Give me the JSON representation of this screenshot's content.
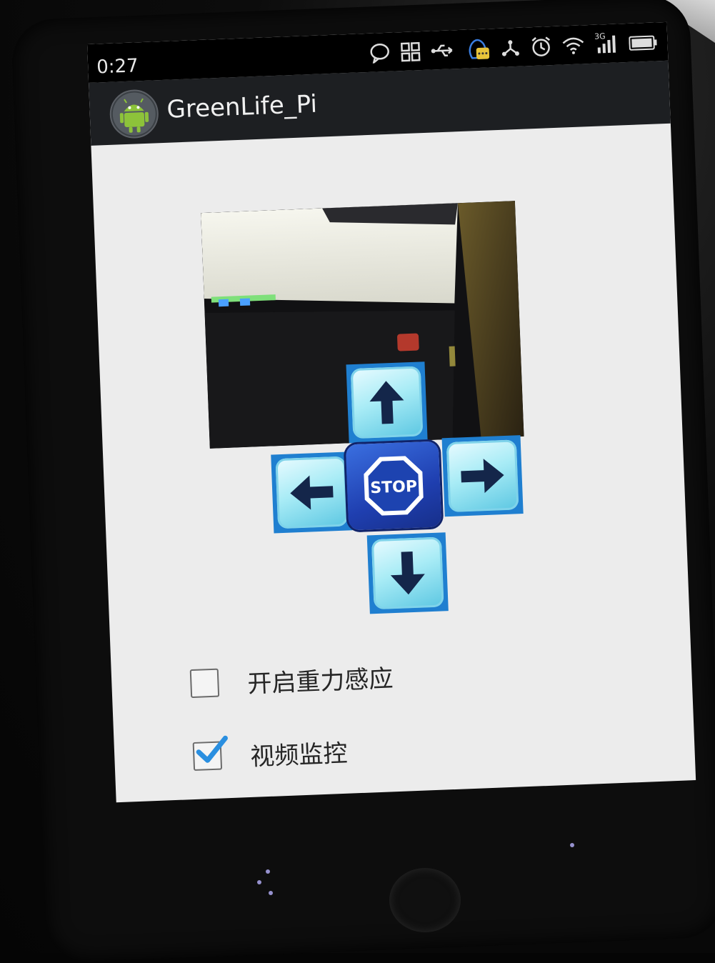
{
  "status_bar": {
    "time": "0:27",
    "network": "3G",
    "icons": [
      "chat-bubble-icon",
      "grid-icon",
      "usb-icon",
      "qq-icon",
      "share-icon",
      "alarm-icon",
      "wifi-icon",
      "signal-icon",
      "battery-icon"
    ]
  },
  "action_bar": {
    "title": "GreenLife_Pi",
    "icon": "android-robot-icon"
  },
  "camera": {
    "label": "camera-feed"
  },
  "dpad": {
    "up": "arrow-up-icon",
    "down": "arrow-down-icon",
    "left": "arrow-left-icon",
    "right": "arrow-right-icon",
    "stop_label": "STOP"
  },
  "options": [
    {
      "label": "开启重力感应",
      "checked": false
    },
    {
      "label": "视频监控",
      "checked": true
    }
  ],
  "colors": {
    "accent": "#1f7fd0",
    "check": "#2a8fe0",
    "stop_blue": "#1f3fb0",
    "screen_bg": "#ececec"
  }
}
